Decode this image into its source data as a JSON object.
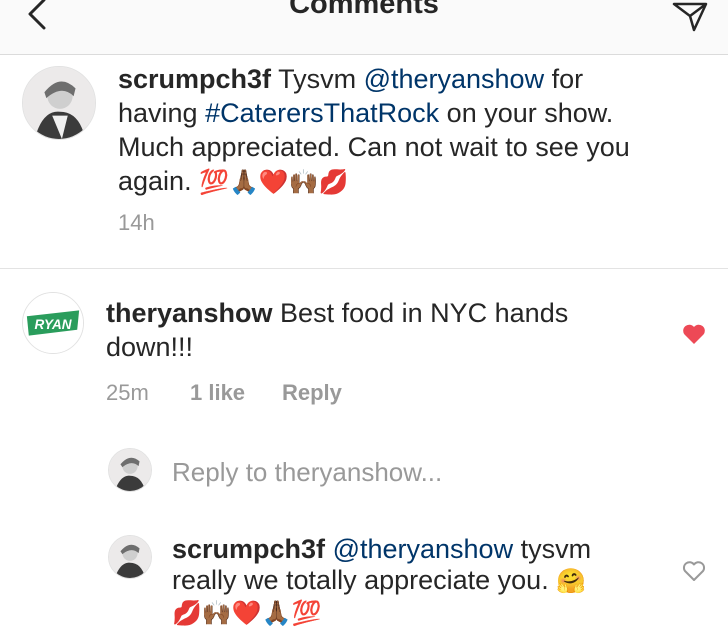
{
  "header": {
    "title": "Comments",
    "back_icon": "chevron-left-icon",
    "send_icon": "paper-plane-icon"
  },
  "caption": {
    "username": "scrumpch3f",
    "text_1": " Tysvm ",
    "mention": "@theryanshow",
    "text_2": " for having ",
    "hashtag": "#CaterersThatRock",
    "text_3": " on your show. Much appreciated. Can not wait to see you again. ",
    "emojis": "💯🙏🏾❤️🙌🏾💋",
    "time": "14h"
  },
  "comment": {
    "username": "theryanshow",
    "text": " Best food in NYC hands down!!!",
    "avatar_text": "RYAN",
    "time": "25m",
    "likes": "1 like",
    "reply_label": "Reply",
    "liked": true
  },
  "reply_input": {
    "placeholder": "Reply to theryanshow..."
  },
  "reply": {
    "username": "scrumpch3f",
    "mention": "@theryanshow",
    "text": " tysvm really we totally appreciate you. ",
    "emoji_1": "🤗",
    "emojis_2": "💋🙌🏾❤️🙏🏾💯",
    "liked": false
  },
  "colors": {
    "link": "#003569",
    "meta": "#999999",
    "heart_red": "#ed4956",
    "ryan_green": "#2a9d5c"
  }
}
